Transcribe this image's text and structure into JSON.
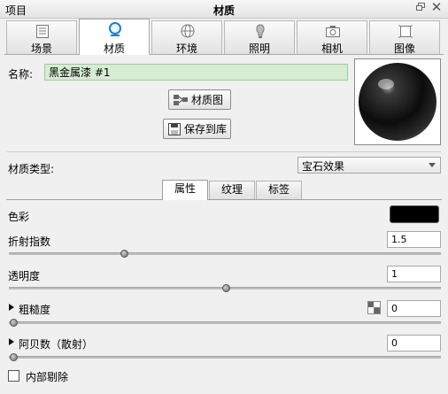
{
  "window": {
    "left_title": "项目",
    "title": "材质"
  },
  "tabs": [
    {
      "label": "场景",
      "icon": "scene-icon"
    },
    {
      "label": "材质",
      "icon": "material-icon",
      "active": true
    },
    {
      "label": "环境",
      "icon": "environment-icon"
    },
    {
      "label": "照明",
      "icon": "lighting-icon"
    },
    {
      "label": "相机",
      "icon": "camera-icon"
    },
    {
      "label": "图像",
      "icon": "image-icon"
    }
  ],
  "material": {
    "name_label": "名称:",
    "name_value": "黑金属漆 #1",
    "graph_button": "材质图",
    "save_button": "保存到库",
    "type_label": "材质类型:",
    "type_value": "宝石效果"
  },
  "subtabs": [
    {
      "label": "属性",
      "active": true
    },
    {
      "label": "纹理"
    },
    {
      "label": "标签"
    }
  ],
  "properties": {
    "color_label": "色彩",
    "color_value": "#000000",
    "ior_label": "折射指数",
    "ior_value": "1.5",
    "ior_slider": 0.26,
    "transparency_label": "透明度",
    "transparency_value": "1",
    "transparency_slider": 0.5,
    "roughness_label": "粗糙度",
    "roughness_value": "0",
    "roughness_slider": 0,
    "abbe_label": "阿贝数（散射）",
    "abbe_value": "0",
    "abbe_slider": 0,
    "inner_remove_label": "内部剔除",
    "inner_remove_checked": false
  },
  "colors": {
    "name_field_bg": "#d6ecd3",
    "accent": "#1a7fd4"
  }
}
